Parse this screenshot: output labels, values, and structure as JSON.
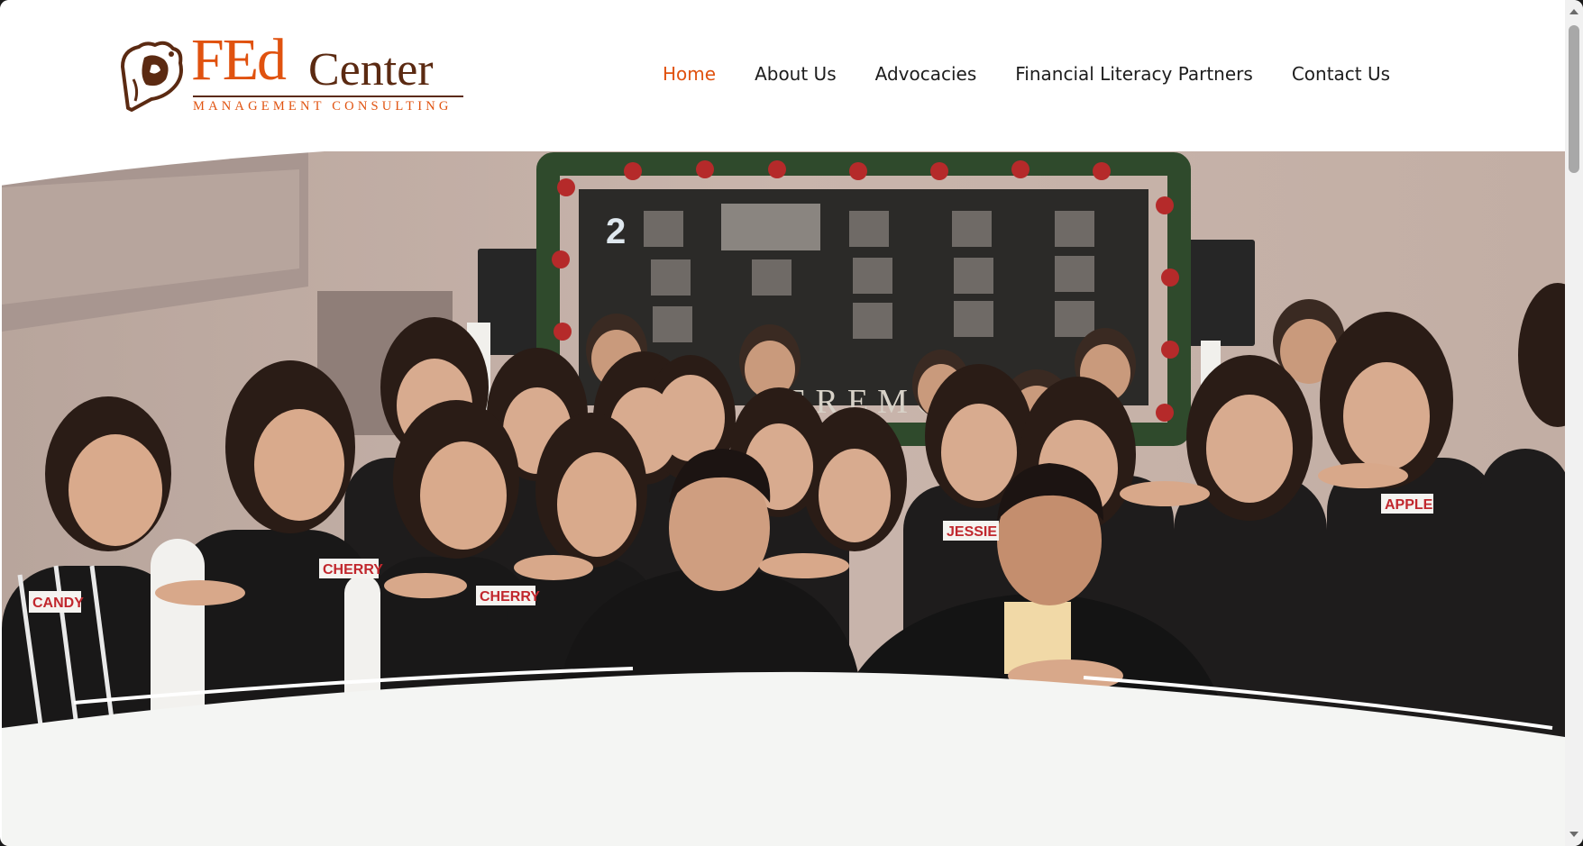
{
  "logo": {
    "brand_fed": "FEd",
    "brand_center": "Center",
    "tagline": "MANAGEMENT CONSULTING",
    "mark_icon": "bear-head-logo-icon"
  },
  "nav": {
    "items": [
      {
        "label": "Home",
        "active": true
      },
      {
        "label": "About Us",
        "active": false
      },
      {
        "label": "Advocacies",
        "active": false
      },
      {
        "label": "Financial Literacy Partners",
        "active": false
      },
      {
        "label": "Contact Us",
        "active": false
      }
    ]
  },
  "hero": {
    "screen_text": "CEREMONY",
    "slide_number": "2",
    "name_tags": [
      "CANDY",
      "CHERRY",
      "CHERRY",
      "JESSIE",
      "APPLE"
    ]
  },
  "colors": {
    "accent": "#e0520f",
    "brand_brown": "#5b2a12",
    "nav_text": "#1d1d1d",
    "wave": "#f4f5f3"
  }
}
